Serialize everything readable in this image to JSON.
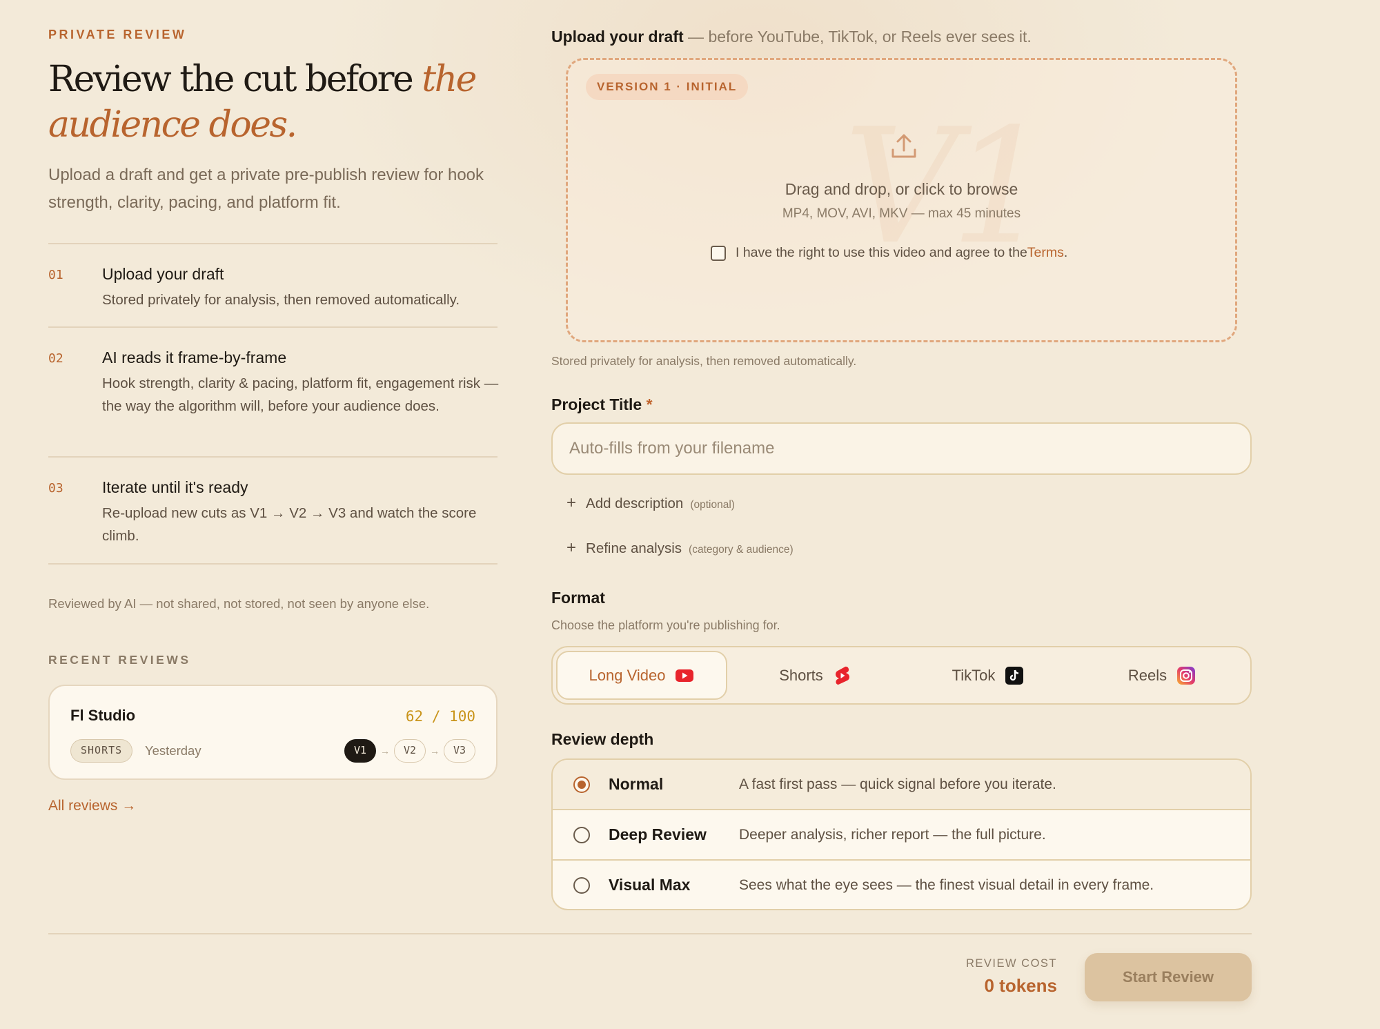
{
  "hero": {
    "eyebrow": "PRIVATE REVIEW",
    "title_prefix": "Review the cut before ",
    "title_accent": "the audience does.",
    "subtitle": "Upload a draft and get a private pre-publish review for hook strength, clarity, pacing, and platform fit."
  },
  "steps": [
    {
      "num": "01",
      "title": "Upload your draft",
      "desc": "Stored privately for analysis, then removed automatically."
    },
    {
      "num": "02",
      "title": "AI reads it frame-by-frame",
      "desc": "Hook strength, clarity & pacing, platform fit, engagement risk — the way the algorithm will, before your audience does."
    },
    {
      "num": "03",
      "title": "Iterate until it's ready",
      "desc": "Re-upload new cuts as V1 → V2 → V3 and watch the score climb."
    }
  ],
  "privacy_note": "Reviewed by AI — not shared, not stored, not seen by anyone else.",
  "recent": {
    "label": "RECENT REVIEWS",
    "card": {
      "title": "Fl Studio",
      "score": "62 / 100",
      "tag": "SHORTS",
      "date": "Yesterday",
      "versions": [
        "V1",
        "V2",
        "V3"
      ]
    },
    "all_link": "All reviews →"
  },
  "upload": {
    "head_bold": "Upload your draft",
    "head_rest": " — before YouTube, TikTok, or Reels ever sees it.",
    "badge": "VERSION 1 · INITIAL",
    "watermark": "V1",
    "drop_title": "Drag and drop, or click to browse",
    "formats": "MP4, MOV, AVI, MKV — max 45 minutes",
    "consent_text": "I have the right to use this video and agree to the ",
    "terms_link": "Terms",
    "consent_end": ".",
    "storage_note": "Stored privately for analysis, then removed automatically."
  },
  "project": {
    "label": "Project Title",
    "required_mark": "*",
    "placeholder": "Auto-fills from your filename",
    "add_description": "Add description",
    "add_description_hint": "(optional)",
    "refine": "Refine analysis",
    "refine_hint": "(category & audience)"
  },
  "format": {
    "label": "Format",
    "hint": "Choose the platform you're publishing for.",
    "tabs": [
      {
        "label": "Long Video",
        "icon": "youtube-icon",
        "active": true
      },
      {
        "label": "Shorts",
        "icon": "youtube-shorts-icon",
        "active": false
      },
      {
        "label": "TikTok",
        "icon": "tiktok-icon",
        "active": false
      },
      {
        "label": "Reels",
        "icon": "instagram-icon",
        "active": false
      }
    ]
  },
  "depth": {
    "label": "Review depth",
    "options": [
      {
        "name": "Normal",
        "desc": "A fast first pass — quick signal before you iterate.",
        "selected": true
      },
      {
        "name": "Deep Review",
        "desc": "Deeper analysis, richer report — the full picture.",
        "selected": false
      },
      {
        "name": "Visual Max",
        "desc": "Sees what the eye sees — the finest visual detail in every frame.",
        "selected": false
      }
    ]
  },
  "footer": {
    "cost_label": "REVIEW COST",
    "cost_value": "0 tokens",
    "start_button": "Start Review"
  },
  "colors": {
    "accent": "#b8642e",
    "background": "#f3ead9",
    "score": "#c9941a"
  }
}
